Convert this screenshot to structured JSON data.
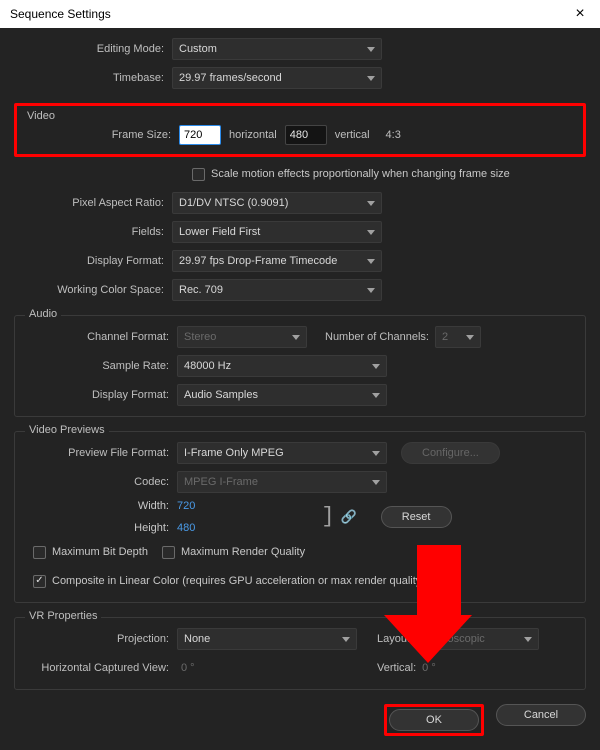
{
  "title": "Sequence Settings",
  "editing_mode": {
    "label": "Editing Mode:",
    "value": "Custom"
  },
  "timebase": {
    "label": "Timebase:",
    "value": "29.97  frames/second"
  },
  "video": {
    "legend": "Video",
    "frame_size_label": "Frame Size:",
    "width": "720",
    "horizontal": "horizontal",
    "height": "480",
    "vertical": "vertical",
    "aspect": "4:3",
    "scale_label": "Scale motion effects proportionally when changing frame size",
    "par": {
      "label": "Pixel Aspect Ratio:",
      "value": "D1/DV NTSC (0.9091)"
    },
    "fields": {
      "label": "Fields:",
      "value": "Lower Field First"
    },
    "display_format": {
      "label": "Display Format:",
      "value": "29.97 fps Drop-Frame Timecode"
    },
    "wcs": {
      "label": "Working Color Space:",
      "value": "Rec. 709"
    }
  },
  "audio": {
    "legend": "Audio",
    "channel_format": {
      "label": "Channel Format:",
      "value": "Stereo"
    },
    "num_channels": {
      "label": "Number of Channels:",
      "value": "2"
    },
    "sample_rate": {
      "label": "Sample Rate:",
      "value": "48000 Hz"
    },
    "display_format": {
      "label": "Display Format:",
      "value": "Audio Samples"
    }
  },
  "previews": {
    "legend": "Video Previews",
    "pff": {
      "label": "Preview File Format:",
      "value": "I-Frame Only MPEG"
    },
    "configure": "Configure...",
    "codec": {
      "label": "Codec:",
      "value": "MPEG I-Frame"
    },
    "width": {
      "label": "Width:",
      "value": "720"
    },
    "height": {
      "label": "Height:",
      "value": "480"
    },
    "reset": "Reset",
    "max_bit": "Maximum Bit Depth",
    "max_render": "Maximum Render Quality",
    "composite": "Composite in Linear Color (requires GPU acceleration or max render quality)"
  },
  "vr": {
    "legend": "VR Properties",
    "projection": {
      "label": "Projection:",
      "value": "None"
    },
    "layout": {
      "label": "Layout:",
      "value": "Monoscopic"
    },
    "hcv": {
      "label": "Horizontal Captured View:",
      "value": "0 °"
    },
    "vert": {
      "label": "Vertical:",
      "value": "0 °"
    }
  },
  "footer": {
    "ok": "OK",
    "cancel": "Cancel"
  }
}
